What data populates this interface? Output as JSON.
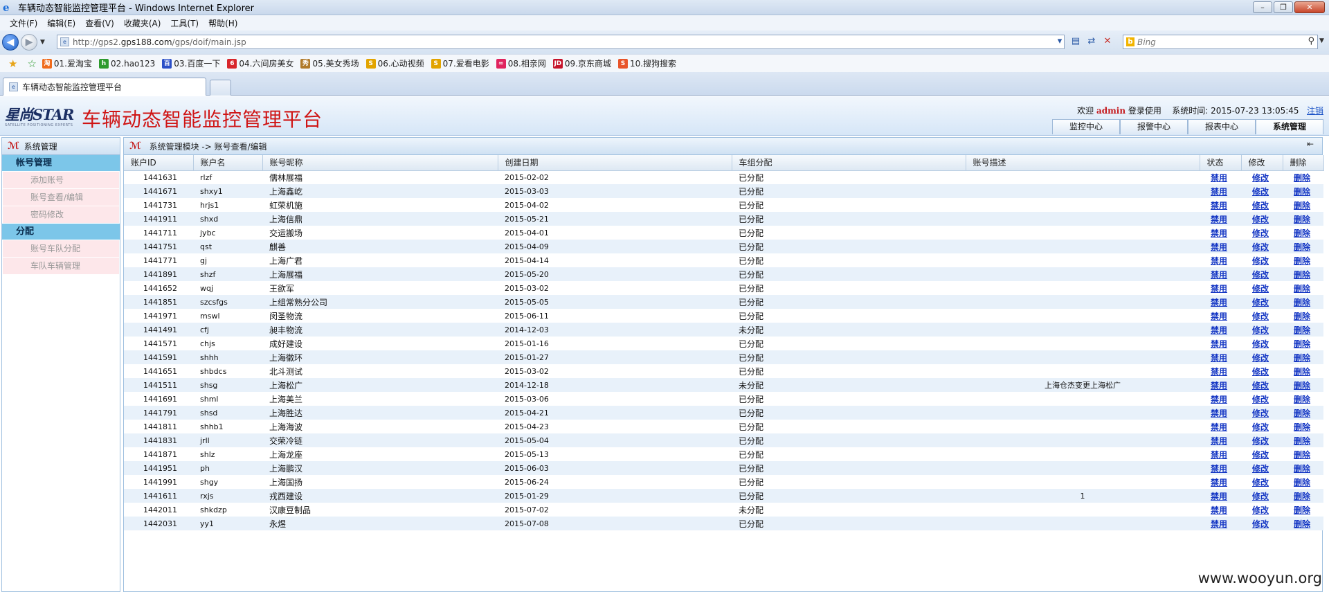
{
  "window": {
    "title": "车辆动态智能监控管理平台 - Windows Internet Explorer",
    "controls": [
      "–",
      "❐",
      "✕"
    ]
  },
  "menu": [
    "文件(F)",
    "编辑(E)",
    "查看(V)",
    "收藏夹(A)",
    "工具(T)",
    "帮助(H)"
  ],
  "address": {
    "prefix": "http://gps2.",
    "host": "gps188.com",
    "path": "/gps/doif/main.jsp",
    "search_placeholder": "Bing"
  },
  "favorites": [
    {
      "label": "01.爱淘宝",
      "icon": "taobao-icon",
      "color": "#f06b1c",
      "glyph": "淘"
    },
    {
      "label": "02.hao123",
      "icon": "hao123-icon",
      "color": "#2e9a2e",
      "glyph": "h"
    },
    {
      "label": "03.百度一下",
      "icon": "baidu-icon",
      "color": "#2b4fc7",
      "glyph": "百"
    },
    {
      "label": "04.六间房美女",
      "icon": "six-rooms-icon",
      "color": "#d8262b",
      "glyph": "6"
    },
    {
      "label": "05.美女秀场",
      "icon": "show-icon",
      "color": "#b07a2a",
      "glyph": "秀"
    },
    {
      "label": "06.心动视频",
      "icon": "video-icon",
      "color": "#e2a400",
      "glyph": "S"
    },
    {
      "label": "07.爱看电影",
      "icon": "movie-icon",
      "color": "#e2a400",
      "glyph": "S"
    },
    {
      "label": "08.相亲网",
      "icon": "dating-icon",
      "color": "#e0245e",
      "glyph": "∞"
    },
    {
      "label": "09.京东商城",
      "icon": "jd-icon",
      "color": "#c6142b",
      "glyph": "JD"
    },
    {
      "label": "10.搜狗搜索",
      "icon": "sogou-icon",
      "color": "#e8542a",
      "glyph": "S"
    }
  ],
  "tab": {
    "label": "车辆动态智能监控管理平台"
  },
  "header": {
    "logo_main": "星尚STAR",
    "logo_sub": "SATELLITE POSITIONING EXPERTS",
    "app_title": "车辆动态智能监控管理平台",
    "welcome_prefix": "欢迎",
    "user": "admin",
    "welcome_suffix": "登录使用",
    "time_label": "系统时间:",
    "time_value": "2015-07-23 13:05:45",
    "logout": "注销",
    "tabs": [
      "监控中心",
      "报警中心",
      "报表中心",
      "系统管理"
    ]
  },
  "sidebar": {
    "title": "系统管理",
    "groups": [
      {
        "label": "帐号管理",
        "items": [
          "添加账号",
          "账号查看/编辑",
          "密码修改"
        ]
      },
      {
        "label": "分配",
        "items": [
          "账号车队分配",
          "车队车辆管理"
        ]
      }
    ]
  },
  "breadcrumb": "系统管理模块 -> 账号查看/编辑",
  "table": {
    "columns": [
      "账户ID",
      "账户名",
      "账号昵称",
      "创建日期",
      "车组分配",
      "账号描述",
      "状态",
      "修改",
      "删除"
    ],
    "actions": {
      "status": "禁用",
      "edit": "修改",
      "delete": "删除"
    },
    "rows": [
      [
        "1441631",
        "rlzf",
        "儒林展福",
        "2015-02-02",
        "已分配",
        ""
      ],
      [
        "1441671",
        "shxy1",
        "上海鑫屹",
        "2015-03-03",
        "已分配",
        ""
      ],
      [
        "1441731",
        "hrjs1",
        "虹荣机施",
        "2015-04-02",
        "已分配",
        ""
      ],
      [
        "1441911",
        "shxd",
        "上海信鼎",
        "2015-05-21",
        "已分配",
        ""
      ],
      [
        "1441711",
        "jybc",
        "交运搬场",
        "2015-04-01",
        "已分配",
        ""
      ],
      [
        "1441751",
        "qst",
        "麒善",
        "2015-04-09",
        "已分配",
        ""
      ],
      [
        "1441771",
        "gj",
        "上海广君",
        "2015-04-14",
        "已分配",
        ""
      ],
      [
        "1441891",
        "shzf",
        "上海展福",
        "2015-05-20",
        "已分配",
        ""
      ],
      [
        "1441652",
        "wqj",
        "王欲军",
        "2015-03-02",
        "已分配",
        ""
      ],
      [
        "1441851",
        "szcsfgs",
        "上组常熟分公司",
        "2015-05-05",
        "已分配",
        ""
      ],
      [
        "1441971",
        "mswl",
        "闵圣物流",
        "2015-06-11",
        "已分配",
        ""
      ],
      [
        "1441491",
        "cfj",
        "昶丰物流",
        "2014-12-03",
        "未分配",
        ""
      ],
      [
        "1441571",
        "chjs",
        "成好建设",
        "2015-01-16",
        "已分配",
        ""
      ],
      [
        "1441591",
        "shhh",
        "上海徽环",
        "2015-01-27",
        "已分配",
        ""
      ],
      [
        "1441651",
        "shbdcs",
        "北斗测试",
        "2015-03-02",
        "已分配",
        ""
      ],
      [
        "1441511",
        "shsg",
        "上海松广",
        "2014-12-18",
        "未分配",
        "上海仓杰变更上海松广"
      ],
      [
        "1441691",
        "shml",
        "上海美兰",
        "2015-03-06",
        "已分配",
        ""
      ],
      [
        "1441791",
        "shsd",
        "上海胜达",
        "2015-04-21",
        "已分配",
        ""
      ],
      [
        "1441811",
        "shhb1",
        "上海海波",
        "2015-04-23",
        "已分配",
        ""
      ],
      [
        "1441831",
        "jrll",
        "交荣冷链",
        "2015-05-04",
        "已分配",
        ""
      ],
      [
        "1441871",
        "shlz",
        "上海龙座",
        "2015-05-13",
        "已分配",
        ""
      ],
      [
        "1441951",
        "ph",
        "上海鹏汉",
        "2015-06-03",
        "已分配",
        ""
      ],
      [
        "1441991",
        "shgy",
        "上海国扬",
        "2015-06-24",
        "已分配",
        ""
      ],
      [
        "1441611",
        "rxjs",
        "戎西建设",
        "2015-01-29",
        "已分配",
        "1"
      ],
      [
        "1442011",
        "shkdzp",
        "汉康豆制品",
        "2015-07-02",
        "未分配",
        ""
      ],
      [
        "1442031",
        "yy1",
        "永煜",
        "2015-07-08",
        "已分配",
        ""
      ]
    ]
  },
  "watermark": "www.wooyun.org"
}
